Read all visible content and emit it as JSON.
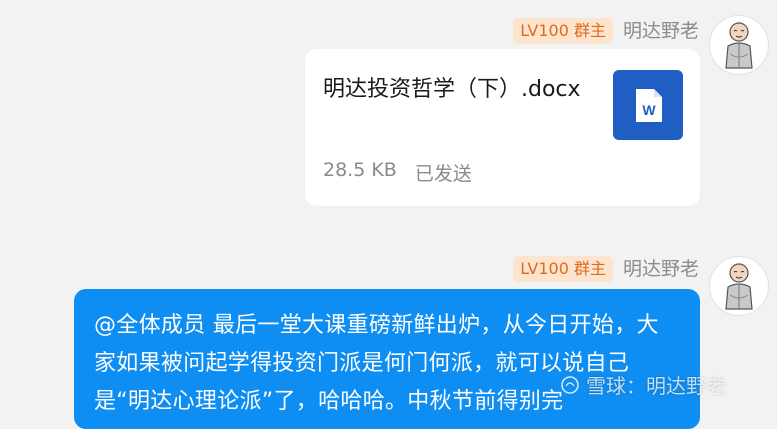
{
  "messages": [
    {
      "badge": "LV100 群主",
      "sender": "明达野老",
      "file": {
        "name": "明达投资哲学（下）.docx",
        "size": "28.5 KB",
        "status": "已发送",
        "icon": "word-document-icon"
      }
    },
    {
      "badge": "LV100 群主",
      "sender": "明达野老",
      "text": "@全体成员 最后一堂大课重磅新鲜出炉，从今日开始，大家如果被问起学得投资门派是何门何派，就可以说自己是“明达心理论派”了，哈哈哈。中秋节前得别完"
    }
  ],
  "watermark": "雪球：明达野老",
  "colors": {
    "background": "#f2f2f2",
    "bubble_blue": "#0e8df2",
    "badge_bg": "#fde4cf",
    "badge_text": "#e06a1a",
    "word_blue": "#1f5fc4"
  }
}
